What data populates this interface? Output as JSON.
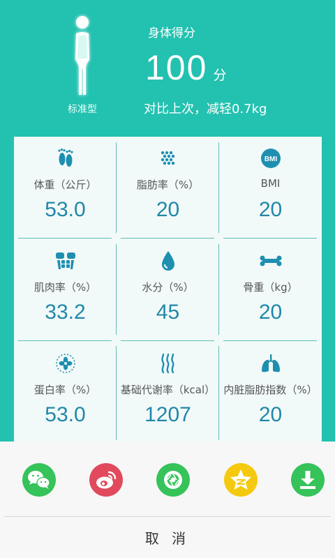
{
  "header": {
    "body_type": "标准型",
    "score_title": "身体得分",
    "score_value": "100",
    "score_unit": "分",
    "compare_text": "对比上次，减轻0.7kg"
  },
  "metrics": [
    {
      "label": "体重（公斤）",
      "value": "53.0",
      "icon": "footprints-icon"
    },
    {
      "label": "脂肪率（%）",
      "value": "20",
      "icon": "fat-cells-icon"
    },
    {
      "label": "BMI",
      "value": "20",
      "icon": "bmi-icon",
      "icon_text": "BMI"
    },
    {
      "label": "肌肉率（%）",
      "value": "33.2",
      "icon": "muscle-icon"
    },
    {
      "label": "水分（%）",
      "value": "45",
      "icon": "water-drop-icon"
    },
    {
      "label": "骨重（kg）",
      "value": "20",
      "icon": "bone-icon"
    },
    {
      "label": "蛋白率（%）",
      "value": "53.0",
      "icon": "protein-icon"
    },
    {
      "label": "基础代谢率（kcal）",
      "value": "1207",
      "icon": "metabolism-flame-icon"
    },
    {
      "label": "内脏脂肪指数（%）",
      "value": "20",
      "icon": "lungs-icon"
    }
  ],
  "share": {
    "targets": [
      {
        "name": "wechat",
        "icon": "wechat-icon",
        "color": "#35c35a"
      },
      {
        "name": "weibo",
        "icon": "weibo-icon",
        "color": "#e14a5c"
      },
      {
        "name": "moments",
        "icon": "moments-icon",
        "color": "#35c35a"
      },
      {
        "name": "qzone",
        "icon": "qzone-icon",
        "color": "#f5c90e"
      },
      {
        "name": "download",
        "icon": "download-icon",
        "color": "#35c35a"
      }
    ],
    "cancel_label": "取 消"
  },
  "colors": {
    "accent": "#23c1b0",
    "value_text": "#2187a8",
    "icon": "#1f8fb0"
  }
}
